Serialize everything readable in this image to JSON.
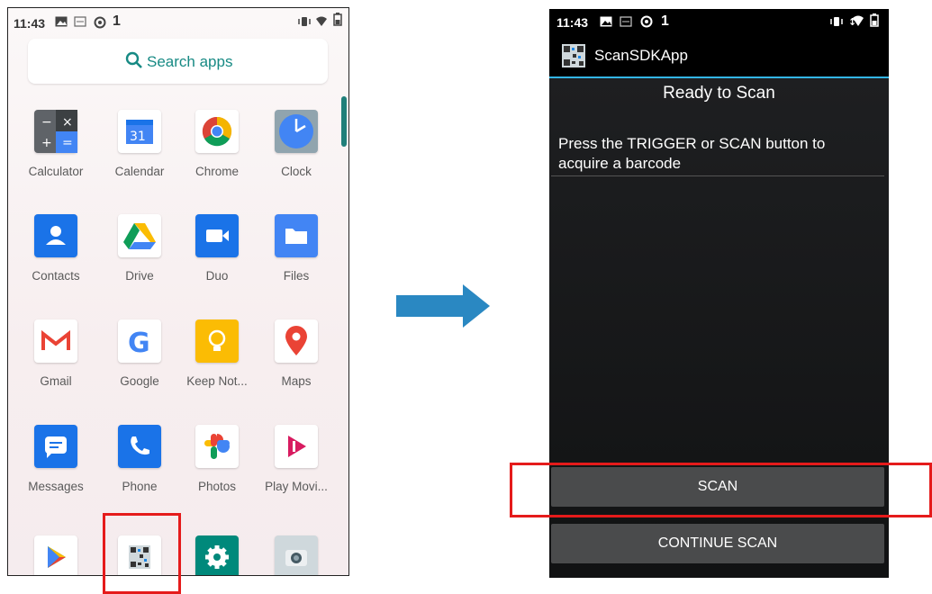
{
  "left_phone": {
    "status_bar": {
      "time": "11:43",
      "notif": "1"
    },
    "search": {
      "placeholder": "Search apps"
    },
    "apps": [
      {
        "label": "Calculator"
      },
      {
        "label": "Calendar"
      },
      {
        "label": "Chrome"
      },
      {
        "label": "Clock"
      },
      {
        "label": "Contacts"
      },
      {
        "label": "Drive"
      },
      {
        "label": "Duo"
      },
      {
        "label": "Files"
      },
      {
        "label": "Gmail"
      },
      {
        "label": "Google"
      },
      {
        "label": "Keep Not..."
      },
      {
        "label": "Maps"
      },
      {
        "label": "Messages"
      },
      {
        "label": "Phone"
      },
      {
        "label": "Photos"
      },
      {
        "label": "Play Movi..."
      }
    ],
    "calendar_day": "31"
  },
  "right_phone": {
    "status_bar": {
      "time": "11:43",
      "notif": "1"
    },
    "app_title": "ScanSDKApp",
    "status_text": "Ready to Scan",
    "instructions": "Press the TRIGGER or SCAN button to acquire a barcode",
    "scan_button": "SCAN",
    "continue_button": "CONTINUE SCAN"
  },
  "colors": {
    "highlight": "#e51b1b",
    "arrow": "#2a88c2",
    "accent_line": "#33b5e5",
    "search_text": "#178a84"
  }
}
